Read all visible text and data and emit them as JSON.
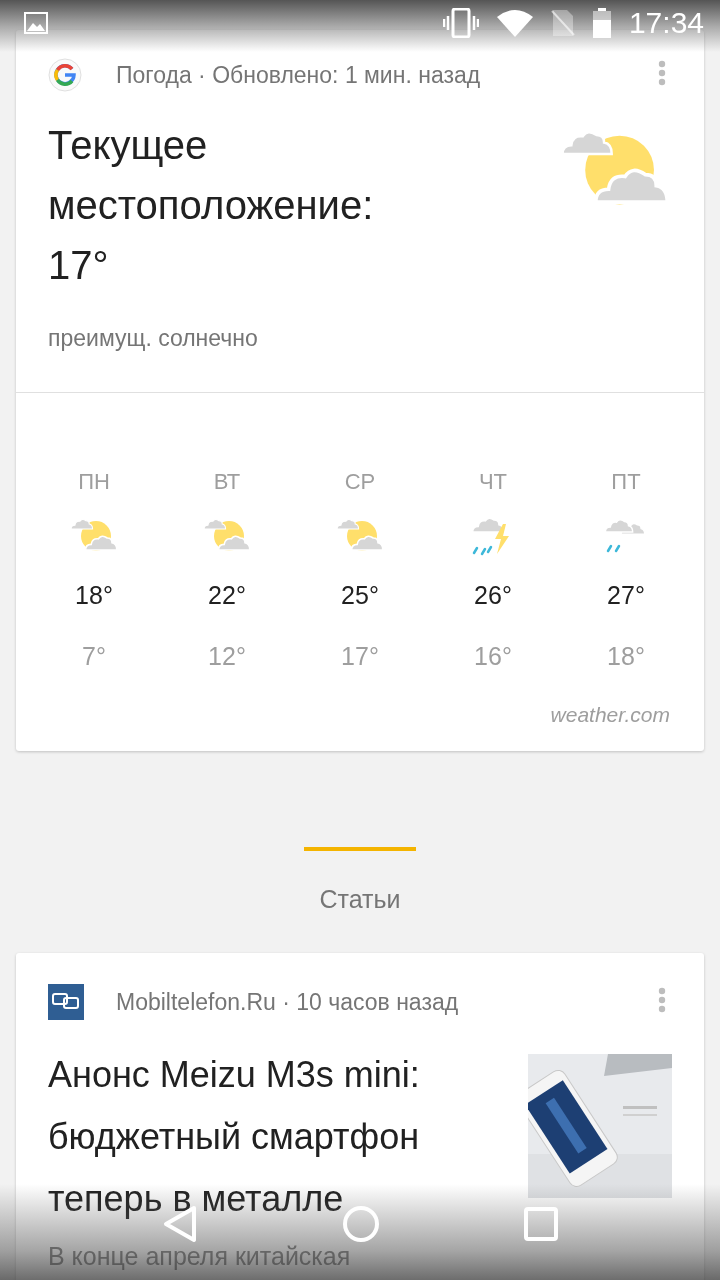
{
  "status_bar": {
    "time": "17:34"
  },
  "weather_card": {
    "source_line": "Погода · Обновлено: 1 мин. назад",
    "title": "Текущее местоположение: 17°",
    "condition": "преимущ. солнечно",
    "forecast": [
      {
        "day": "ПН",
        "kind": "partly-sunny",
        "high": "18°",
        "low": "7°"
      },
      {
        "day": "ВТ",
        "kind": "partly-sunny",
        "high": "22°",
        "low": "12°"
      },
      {
        "day": "СР",
        "kind": "partly-sunny",
        "high": "25°",
        "low": "17°"
      },
      {
        "day": "ЧТ",
        "kind": "thunderstorm",
        "high": "26°",
        "low": "16°"
      },
      {
        "day": "ПТ",
        "kind": "rain-cloudy",
        "high": "27°",
        "low": "18°"
      }
    ],
    "attribution": "weather.com"
  },
  "section": {
    "title": "Статьи"
  },
  "article": {
    "source_line": "Mobiltelefon.Ru · 10 часов назад",
    "title": "Анонс Meizu M3s mini: бюджетный смартфон теперь в металле",
    "snippet": "В конце апреля китайская"
  }
}
